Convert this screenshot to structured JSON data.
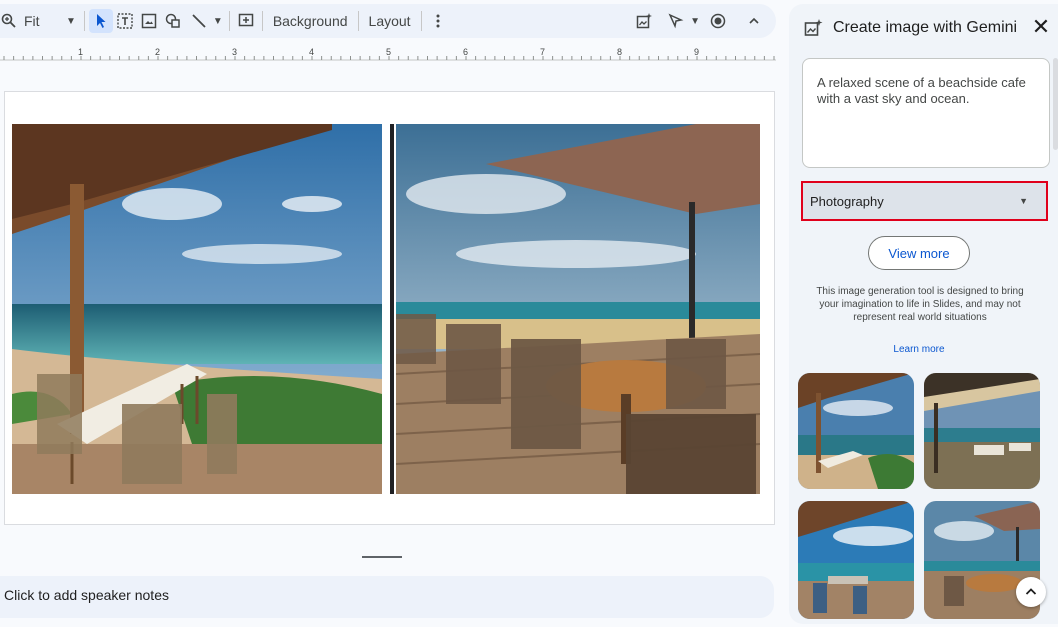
{
  "toolbar": {
    "zoom_label": "Fit",
    "background_label": "Background",
    "layout_label": "Layout"
  },
  "ruler": {
    "ticks": [
      "1",
      "2",
      "3",
      "4",
      "5",
      "6",
      "7",
      "8",
      "9"
    ]
  },
  "notes": {
    "placeholder": "Click to add speaker notes"
  },
  "panel": {
    "title": "Create image with Gemini",
    "close_icon": "close-icon",
    "prompt_text": "A relaxed scene of a beachside cafe with a vast sky and ocean.",
    "style_value": "Photography",
    "view_more_label": "View more",
    "disclaimer": "This image generation tool is designed to bring your imagination to life in Slides, and may not represent real world situations",
    "learn_more_label": "Learn more"
  },
  "colors": {
    "accent": "#0b57d0",
    "highlight_border": "#e0001b",
    "panel_bg": "#f0f4f9",
    "toolbar_bg": "#edf2fa"
  }
}
